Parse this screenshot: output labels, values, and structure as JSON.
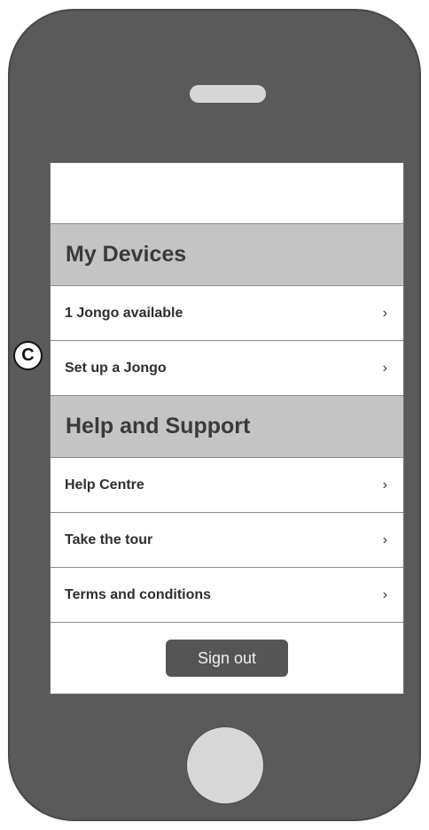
{
  "sections": [
    {
      "title": "My Devices",
      "items": [
        {
          "label": "1 Jongo available",
          "chevron": "›"
        },
        {
          "label": "Set up a Jongo",
          "chevron": "›"
        }
      ]
    },
    {
      "title": "Help and Support",
      "items": [
        {
          "label": "Help Centre",
          "chevron": "›"
        },
        {
          "label": "Take the tour",
          "chevron": "›"
        },
        {
          "label": "Terms and conditions",
          "chevron": "›"
        }
      ]
    }
  ],
  "sign_out_label": "Sign out",
  "callout_letter": "C",
  "icons": {
    "chevron": "chevron-right-icon"
  },
  "colors": {
    "phone_body": "#5a5a5a",
    "section_header": "#c4c4c4",
    "sign_out_button": "#555555"
  }
}
